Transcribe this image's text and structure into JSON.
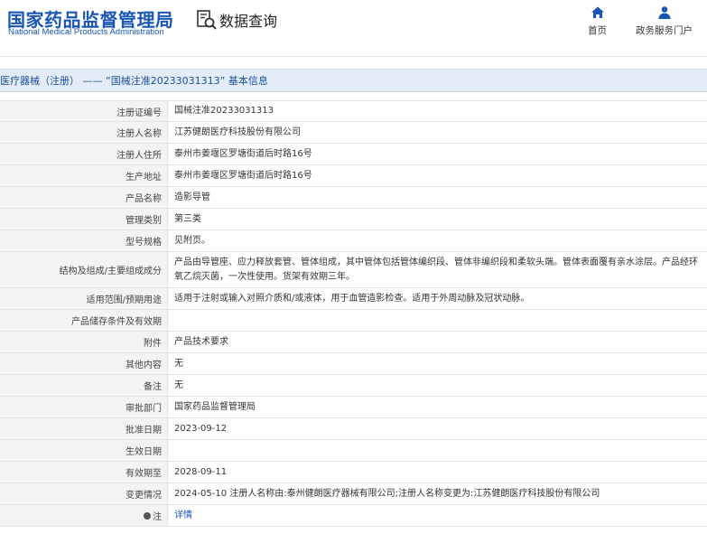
{
  "header": {
    "logo_cn": "国家药品监督管理局",
    "logo_en": "National Medical Products Administration",
    "query_label": "数据查询",
    "nav": [
      {
        "label": "首页",
        "icon": "home-icon"
      },
      {
        "label": "政务服务门户",
        "icon": "user-icon"
      }
    ]
  },
  "breadcrumb": "医疗器械（注册） —— “国械注准20233031313” 基本信息",
  "rows": [
    {
      "label": "注册证编号",
      "value": "国械注准20233031313"
    },
    {
      "label": "注册人名称",
      "value": "江苏健朗医疗科技股份有限公司"
    },
    {
      "label": "注册人住所",
      "value": "泰州市姜堰区罗塘街道后时路16号"
    },
    {
      "label": "生产地址",
      "value": "泰州市姜堰区罗塘街道后时路16号"
    },
    {
      "label": "产品名称",
      "value": "造影导管"
    },
    {
      "label": "管理类别",
      "value": "第三类"
    },
    {
      "label": "型号规格",
      "value": "见附页。"
    },
    {
      "label": "结构及组成/主要组成成分",
      "value": "产品由导管座、应力释放套管、管体组成，其中管体包括管体编织段、管体非编织段和柔软头端。管体表面覆有亲水涂层。产品经环氧乙烷灭菌，一次性使用。货架有效期三年。"
    },
    {
      "label": "适用范围/预期用途",
      "value": "适用于注射或输入对照介质和/或液体，用于血管造影检查。适用于外周动脉及冠状动脉。"
    },
    {
      "label": "产品储存条件及有效期",
      "value": ""
    },
    {
      "label": "附件",
      "value": "产品技术要求"
    },
    {
      "label": "其他内容",
      "value": "无"
    },
    {
      "label": "备注",
      "value": "无"
    },
    {
      "label": "审批部门",
      "value": "国家药品监督管理局"
    },
    {
      "label": "批准日期",
      "value": "2023-09-12"
    },
    {
      "label": "生效日期",
      "value": ""
    },
    {
      "label": "有效期至",
      "value": "2028-09-11"
    },
    {
      "label": "变更情况",
      "value": "2024-05-10 注册人名称由:泰州健朗医疗器械有限公司;注册人名称变更为:江苏健朗医疗科技股份有限公司"
    },
    {
      "label": "注",
      "value": "详情"
    }
  ],
  "colors": {
    "brand": "#1a56b4",
    "crumb_bg": "#e4edf7",
    "label_bg": "#f3f3f3"
  }
}
